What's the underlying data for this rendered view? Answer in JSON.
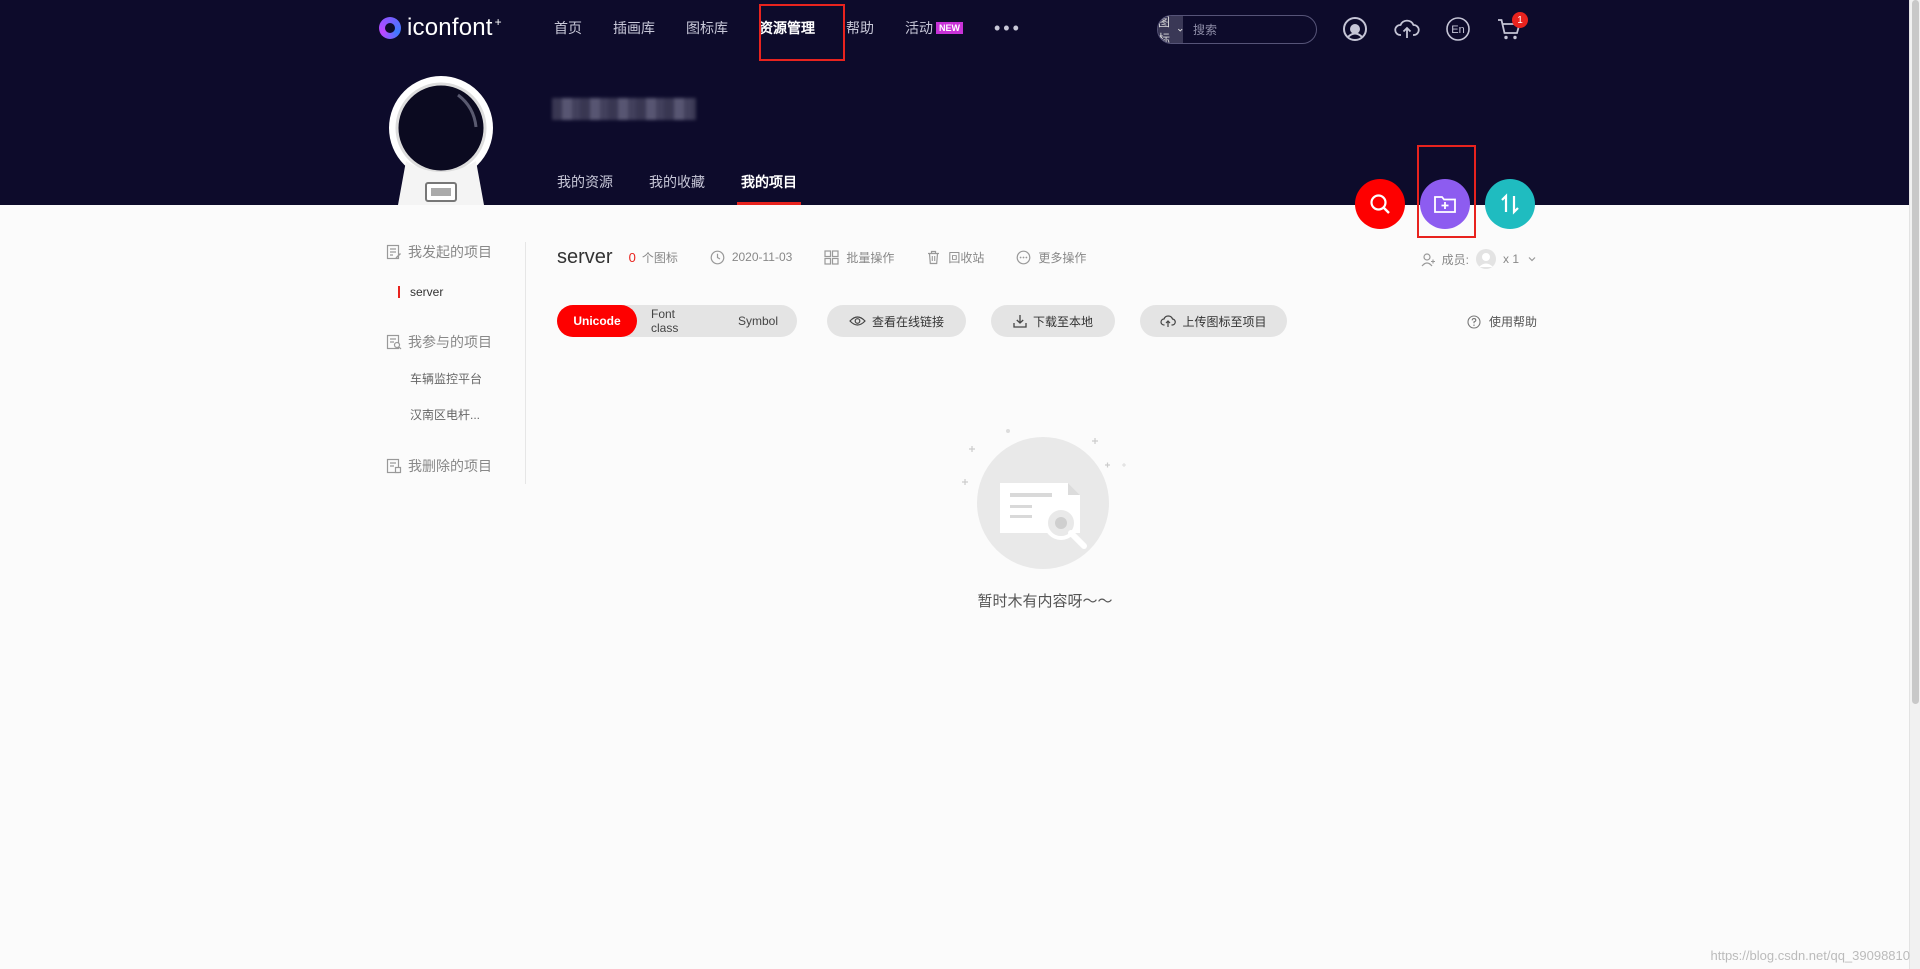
{
  "app": {
    "logo_text": "iconfont",
    "logo_star": "+"
  },
  "nav": {
    "items": [
      {
        "label": "首页"
      },
      {
        "label": "插画库"
      },
      {
        "label": "图标库"
      },
      {
        "label": "资源管理",
        "active": true
      },
      {
        "label": "帮助"
      },
      {
        "label": "活动",
        "badge": "NEW"
      }
    ],
    "more": "•••"
  },
  "search": {
    "type": "图标",
    "placeholder": "搜索"
  },
  "top_icons": {
    "lang": "En",
    "cart_count": "1"
  },
  "profile": {
    "tabs": [
      "我的资源",
      "我的收藏",
      "我的项目"
    ],
    "active_tab": "我的项目"
  },
  "fabs": [
    {
      "icon": "search-icon",
      "color": "#fe0000"
    },
    {
      "icon": "folder-add-icon",
      "color": "#8d5cf0"
    },
    {
      "icon": "sort-icon",
      "color": "#1fbcc0"
    }
  ],
  "sidebar": {
    "created_title": "我发起的项目",
    "created_items": [
      "server"
    ],
    "joined_title": "我参与的项目",
    "joined_items": [
      "车辆监控平台",
      "汉南区电杆..."
    ],
    "deleted_title": "我删除的项目"
  },
  "project": {
    "name": "server",
    "icon_count": "0",
    "icon_count_label": "个图标",
    "date": "2020-11-03",
    "batch": "批量操作",
    "recycle": "回收站",
    "more_ops": "更多操作",
    "members_label": "成员:",
    "members_count": "x 1"
  },
  "toolbar": {
    "formats": [
      "Unicode",
      "Font class",
      "Symbol"
    ],
    "active_format": "Unicode",
    "view_link": "查看在线链接",
    "download": "下载至本地",
    "upload": "上传图标至项目",
    "help": "使用帮助"
  },
  "empty": {
    "text": "暂时木有内容呀～～"
  },
  "watermark": "https://blog.csdn.net/qq_39098810",
  "colors": {
    "header_bg": "#0d0b2b",
    "accent_red": "#fe0000",
    "highlight_box": "#e8231e",
    "purple": "#8d5cf0",
    "teal": "#1fbcc0"
  }
}
